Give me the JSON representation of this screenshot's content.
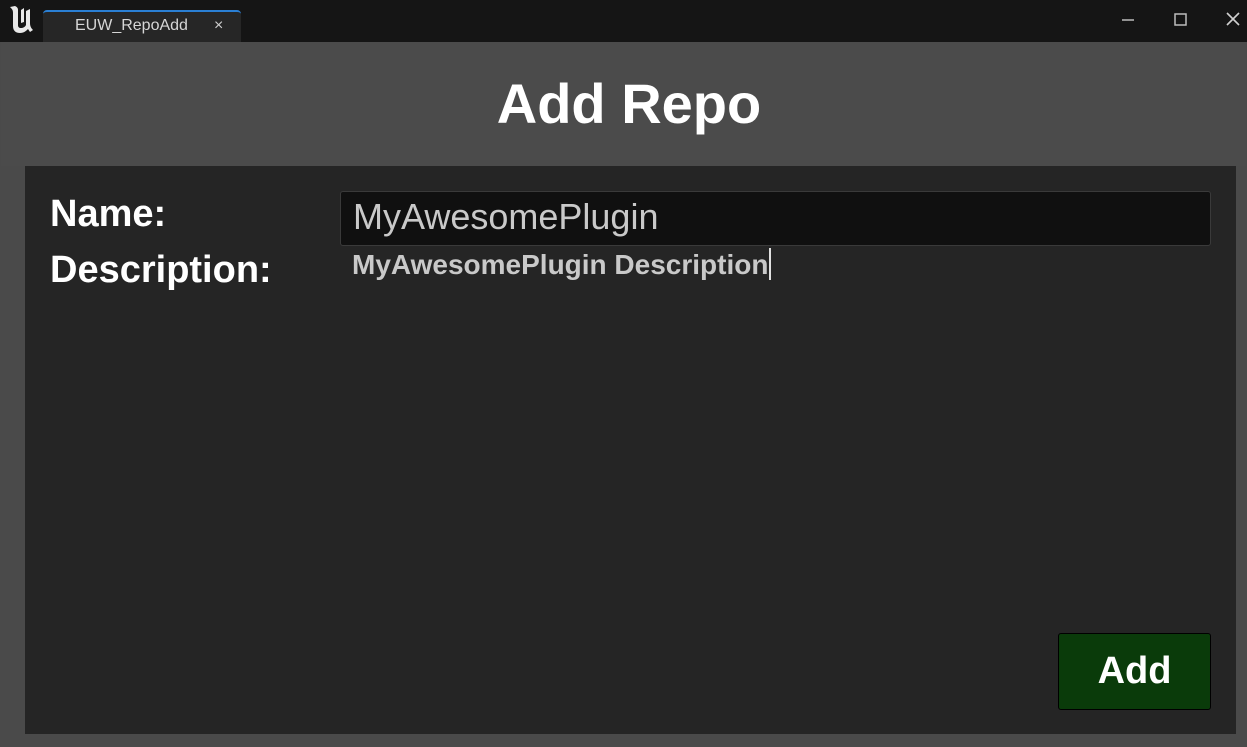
{
  "window": {
    "tab_title": "EUW_RepoAdd",
    "tab_close_glyph": "×",
    "icons": [
      "unreal-logo-icon",
      "minimize-icon",
      "maximize-icon",
      "close-icon"
    ]
  },
  "header": {
    "title": "Add Repo"
  },
  "form": {
    "name_label": "Name:",
    "name_value": "MyAwesomePlugin",
    "description_label": "Description:",
    "description_value": "MyAwesomePlugin Description"
  },
  "actions": {
    "add_label": "Add"
  },
  "colors": {
    "titlebar": "#151515",
    "panel": "#252525",
    "add_button": "#0a3b0a",
    "tab_accent": "#2a7fd4"
  }
}
